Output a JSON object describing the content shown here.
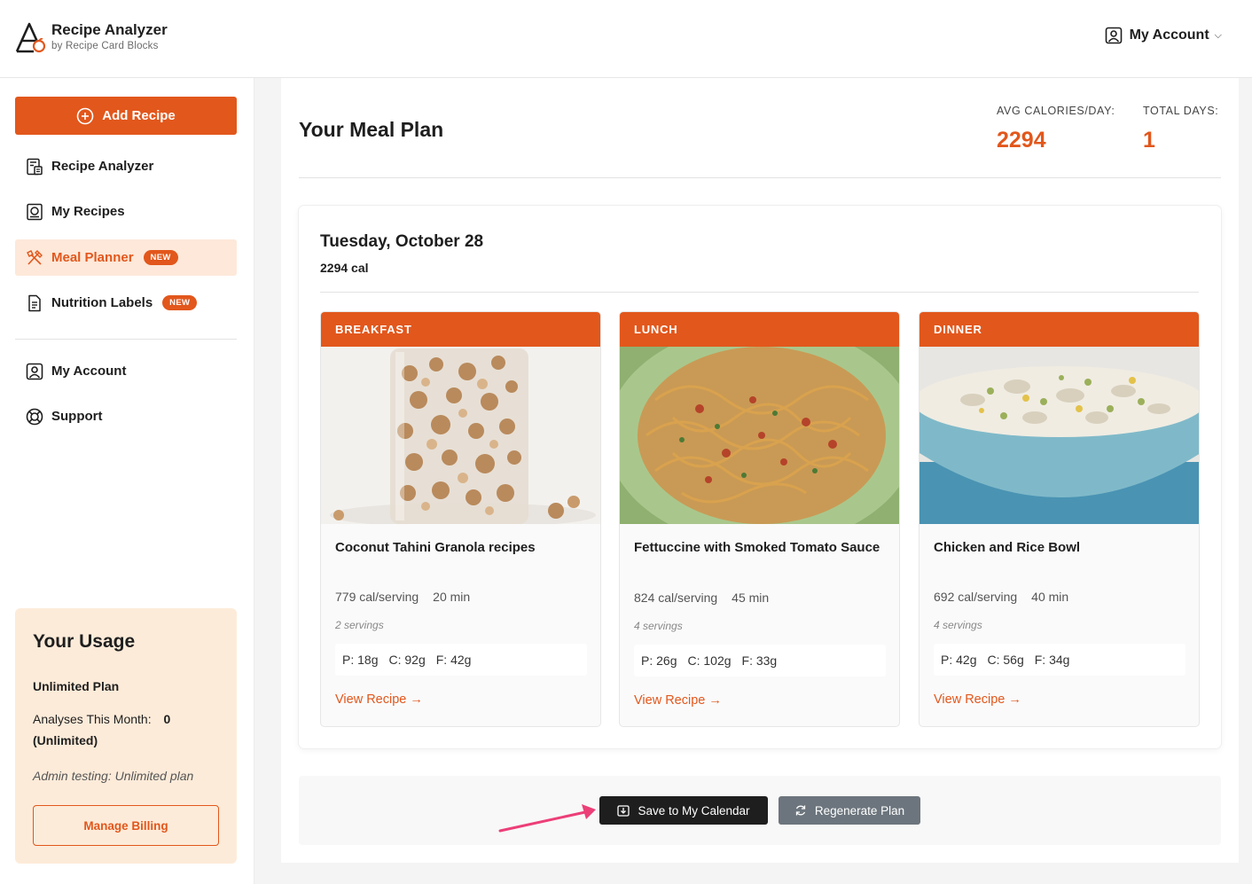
{
  "brand": {
    "title": "Recipe Analyzer",
    "subtitle": "by Recipe Card Blocks",
    "accent": "#e2571c"
  },
  "header": {
    "account_label": "My Account",
    "account_icon": "user-square-icon",
    "chevron": "⌵"
  },
  "sidebar": {
    "add_button": "Add Recipe",
    "items": [
      {
        "label": "Recipe Analyzer",
        "icon": "calculator-icon"
      },
      {
        "label": "My Recipes",
        "icon": "recipe-book-icon"
      },
      {
        "label": "Meal Planner",
        "icon": "utensils-cross-icon",
        "badge": "NEW",
        "active": true
      },
      {
        "label": "Nutrition Labels",
        "icon": "document-icon",
        "badge": "NEW"
      },
      {
        "label": "My Account",
        "icon": "user-square-icon"
      },
      {
        "label": "Support",
        "icon": "lifebuoy-icon"
      }
    ],
    "usage": {
      "title": "Your Usage",
      "plan": "Unlimited Plan",
      "analyses_label": "Analyses This Month:",
      "analyses_value": "0",
      "analyses_note": "(Unlimited)",
      "admin_note": "Admin testing: Unlimited plan",
      "manage_button": "Manage Billing"
    }
  },
  "main": {
    "title": "Your Meal Plan",
    "stats": [
      {
        "label": "AVG CALORIES/DAY:",
        "value": "2294"
      },
      {
        "label": "TOTAL DAYS:",
        "value": "1"
      }
    ],
    "day": {
      "title": "Tuesday, October 28",
      "calories": "2294 cal",
      "meals": [
        {
          "type": "BREAKFAST",
          "name": "Coconut Tahini Granola recipes",
          "calories": "779 cal/serving",
          "time": "20 min",
          "servings": "2 servings",
          "protein": "P: 18g",
          "carbs": "C: 92g",
          "fat": "F: 42g",
          "link": "View Recipe →"
        },
        {
          "type": "LUNCH",
          "name": "Fettuccine with Smoked Tomato Sauce",
          "calories": "824 cal/serving",
          "time": "45 min",
          "servings": "4 servings",
          "protein": "P: 26g",
          "carbs": "C: 102g",
          "fat": "F: 33g",
          "link": "View Recipe →"
        },
        {
          "type": "DINNER",
          "name": "Chicken and Rice Bowl",
          "calories": "692 cal/serving",
          "time": "40 min",
          "servings": "4 servings",
          "protein": "P: 42g",
          "carbs": "C: 56g",
          "fat": "F: 34g",
          "link": "View Recipe →"
        }
      ]
    },
    "actions": {
      "save": "Save to My Calendar",
      "regenerate": "Regenerate Plan"
    }
  }
}
